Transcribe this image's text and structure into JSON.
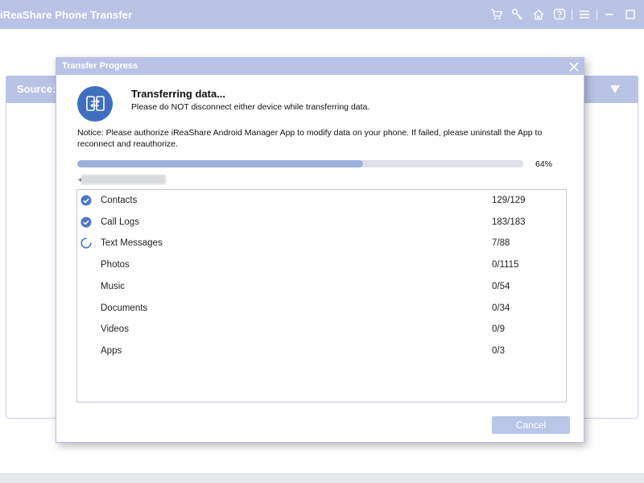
{
  "app": {
    "title": "iReaShare Phone Transfer",
    "icons": [
      "cart-icon",
      "key-icon",
      "home-icon",
      "help-icon",
      "menu-icon",
      "minimize-icon",
      "maximize-icon"
    ]
  },
  "background": {
    "source_label": "Source:"
  },
  "dialog": {
    "title": "Transfer Progress",
    "status_title": "Transferring data...",
    "status_subtitle": "Please do NOT disconnect either device while transferring data.",
    "notice": "Notice: Please authorize iReaShare Android Manager App to modify data on your phone. If failed, please uninstall the App to reconnect and reauthorize.",
    "progress": {
      "percent": 64,
      "label": "64%"
    },
    "current_file_prefix": "+",
    "items": [
      {
        "name": "Contacts",
        "count": "129/129",
        "status": "done"
      },
      {
        "name": "Call Logs",
        "count": "183/183",
        "status": "done"
      },
      {
        "name": "Text Messages",
        "count": "7/88",
        "status": "in-progress"
      },
      {
        "name": "Photos",
        "count": "0/1115",
        "status": "pending"
      },
      {
        "name": "Music",
        "count": "0/54",
        "status": "pending"
      },
      {
        "name": "Documents",
        "count": "0/34",
        "status": "pending"
      },
      {
        "name": "Videos",
        "count": "0/9",
        "status": "pending"
      },
      {
        "name": "Apps",
        "count": "0/3",
        "status": "pending"
      }
    ],
    "cancel_label": "Cancel"
  },
  "colors": {
    "titlebar": "#b9c3e6",
    "accent": "#3f6fbe",
    "progress_fill": "#9db1dd",
    "check": "#4a78c8"
  }
}
